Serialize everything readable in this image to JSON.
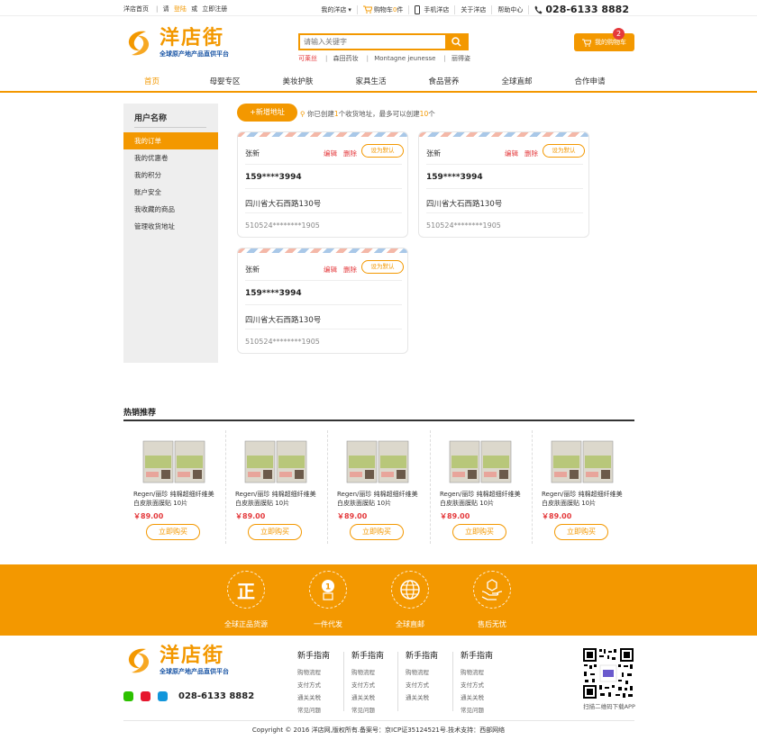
{
  "topbar": {
    "home": "洋店首页",
    "please": "请",
    "login": "登陆",
    "or": "或",
    "register": "立即注册",
    "my_store": "我的洋店",
    "cart_prefix": "购物车",
    "cart_count": "0",
    "cart_suffix": "件",
    "mobile": "手机洋店",
    "about": "关于洋店",
    "help": "帮助中心",
    "phone": "028-6133 8882"
  },
  "header": {
    "logo_name": "洋店街",
    "logo_slogan": "全球原产地产品直供平台",
    "search_placeholder": "请输入关键字",
    "hot_words": [
      "可莱丝",
      "森田药妆",
      "Montagne jeunesse",
      "丽得姿"
    ],
    "cart_button": "我的购物车",
    "cart_badge": "2"
  },
  "nav": [
    "首页",
    "母婴专区",
    "美妆护肤",
    "家具生活",
    "食品营养",
    "全球直邮",
    "合作申请"
  ],
  "sidebar": {
    "title": "用户名称",
    "items": [
      "我的订单",
      "我的优惠卷",
      "我的积分",
      "账户安全",
      "我收藏的商品",
      "管理收货地址"
    ]
  },
  "address": {
    "add_button": "+新增地址",
    "info_pre": "你已创建",
    "info_count": "1",
    "info_mid": "个收货地址，最多可以创建",
    "info_max": "10",
    "info_post": "个",
    "cards": [
      {
        "name": "张新",
        "edit": "编辑",
        "delete": "删除",
        "default": "设为默认",
        "phone": "159****3994",
        "addr": "四川省大石西路130号",
        "id": "510524********1905"
      },
      {
        "name": "张新",
        "edit": "编辑",
        "delete": "删除",
        "default": "设为默认",
        "phone": "159****3994",
        "addr": "四川省大石西路130号",
        "id": "510524********1905"
      },
      {
        "name": "张新",
        "edit": "编辑",
        "delete": "删除",
        "default": "设为默认",
        "phone": "159****3994",
        "addr": "四川省大石西路130号",
        "id": "510524********1905"
      }
    ]
  },
  "hot": {
    "title": "热销推荐",
    "products": [
      {
        "name": "Regen/丽珍 纯棉超细纤维美白皮肤面膜贴 10片",
        "price": "￥89.00",
        "buy": "立即购买"
      },
      {
        "name": "Regen/丽珍 纯棉超细纤维美白皮肤面膜贴 10片",
        "price": "￥89.00",
        "buy": "立即购买"
      },
      {
        "name": "Regen/丽珍 纯棉超细纤维美白皮肤面膜贴 10片",
        "price": "￥89.00",
        "buy": "立即购买"
      },
      {
        "name": "Regen/丽珍 纯棉超细纤维美白皮肤面膜贴 10片",
        "price": "￥89.00",
        "buy": "立即购买"
      },
      {
        "name": "Regen/丽珍 纯棉超细纤维美白皮肤面膜贴 10片",
        "price": "￥89.00",
        "buy": "立即购买"
      }
    ]
  },
  "features": [
    {
      "glyph": "正",
      "label": "全球正品货源",
      "icon": "genuine-icon"
    },
    {
      "glyph": "1",
      "label": "一件代发",
      "icon": "one-piece-icon"
    },
    {
      "glyph": "",
      "label": "全球直邮",
      "icon": "globe-icon"
    },
    {
      "glyph": "",
      "label": "售后无忧",
      "icon": "service-icon"
    }
  ],
  "footer": {
    "logo_name": "洋店街",
    "logo_slogan": "全球原产地产品直供平台",
    "phone": "028-6133 8882",
    "columns": [
      {
        "title": "新手指南",
        "links": [
          "购物流程",
          "支付方式",
          "通关关税",
          "常见问题"
        ]
      },
      {
        "title": "新手指南",
        "links": [
          "购物流程",
          "支付方式",
          "通关关税",
          "常见问题"
        ]
      },
      {
        "title": "新手指南",
        "links": [
          "购物流程",
          "支付方式",
          "通关关税"
        ]
      },
      {
        "title": "新手指南",
        "links": [
          "购物流程",
          "支付方式",
          "通关关税",
          "常见问题"
        ]
      }
    ],
    "qr_label": "扫描二维码下载APP",
    "copyright": "Copyright © 2016 洋店网,版权所有.备案号：京ICP证35124521号.技术支持：西部网络"
  },
  "colors": {
    "accent": "#f39800",
    "price": "#e4393c",
    "brand_blue": "#1a55a5"
  }
}
